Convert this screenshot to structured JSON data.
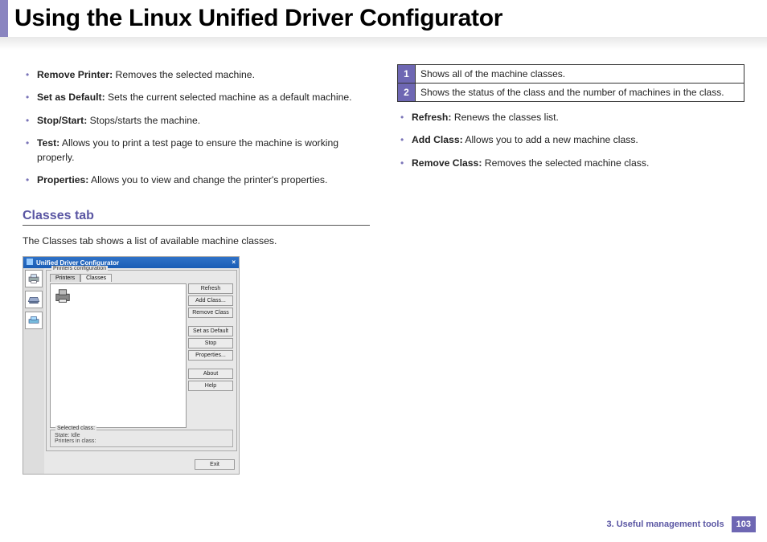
{
  "title": "Using the Linux Unified Driver Configurator",
  "left": {
    "bullets": [
      {
        "term": "Remove Printer:",
        "desc": " Removes the selected machine."
      },
      {
        "term": "Set as Default:",
        "desc": " Sets the current selected machine as a default machine."
      },
      {
        "term": "Stop/Start:",
        "desc": " Stops/starts the machine."
      },
      {
        "term": "Test:",
        "desc": " Allows you to print a test page to ensure the machine is working properly."
      },
      {
        "term": "Properties:",
        "desc": " Allows you to view and change the printer's properties."
      }
    ],
    "section_heading": "Classes tab",
    "section_intro": "The Classes tab shows a list of available machine classes."
  },
  "right": {
    "table": [
      {
        "num": "1",
        "desc": "Shows all of the machine classes."
      },
      {
        "num": "2",
        "desc": "Shows the status of the class and the number of machines in the class."
      }
    ],
    "bullets": [
      {
        "term": "Refresh:",
        "desc": " Renews the classes list."
      },
      {
        "term": "Add Class:",
        "desc": " Allows you to add a new machine class."
      },
      {
        "term": "Remove Class:",
        "desc": " Removes the selected machine class."
      }
    ]
  },
  "screenshot": {
    "window_title": "Unified Driver Configurator",
    "fieldset_label": "Printers configuration",
    "tabs": [
      "Printers",
      "Classes"
    ],
    "buttons": [
      "Refresh",
      "Add Class...",
      "Remove Class",
      "Set as Default",
      "Stop",
      "Properties...",
      "About",
      "Help"
    ],
    "status_label": "Selected class:",
    "status_lines": [
      "State: Idle",
      "Printers in class:"
    ],
    "exit": "Exit"
  },
  "footer": {
    "chapter": "3.  Useful management tools",
    "page": "103"
  }
}
